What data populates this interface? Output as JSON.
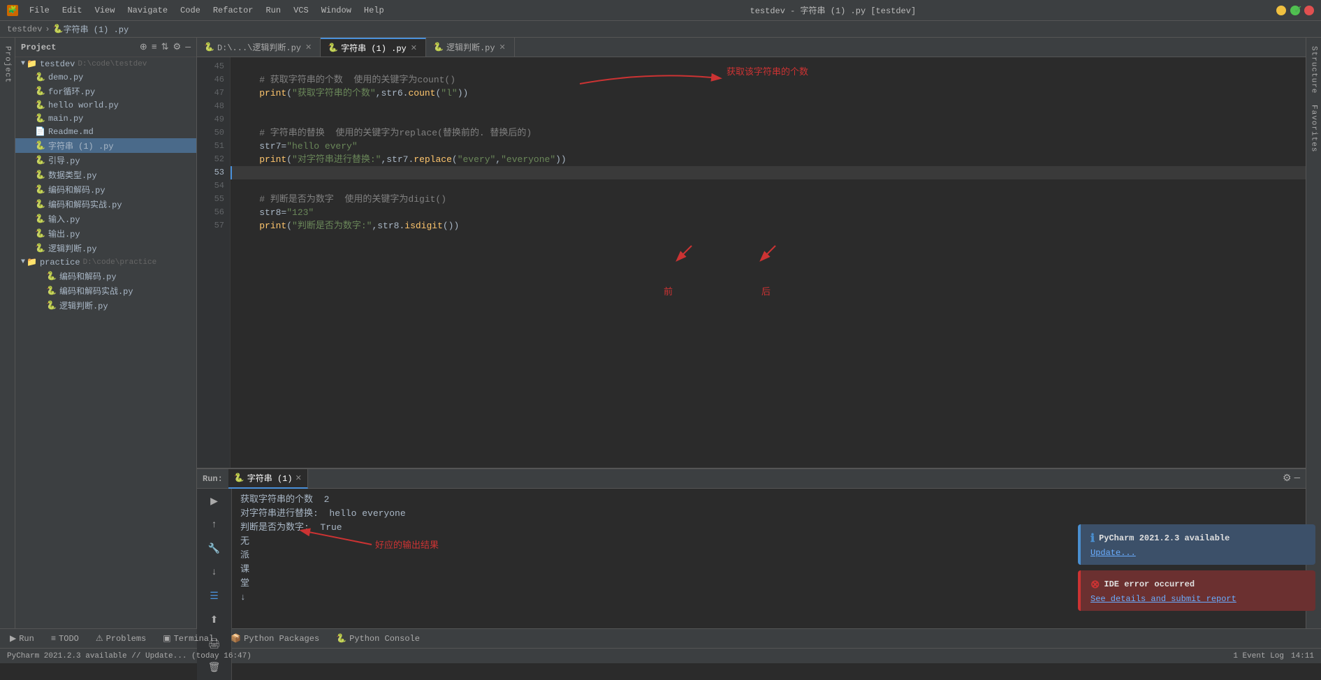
{
  "titleBar": {
    "appIcon": "▶",
    "menu": [
      "File",
      "Edit",
      "View",
      "Navigate",
      "Code",
      "Refactor",
      "Run",
      "VCS",
      "Window",
      "Help"
    ],
    "title": "testdev - 字符串 (1) .py [testdev]",
    "winMin": "—",
    "winMax": "□",
    "winClose": "✕"
  },
  "breadcrumb": {
    "project": "testdev",
    "sep1": "›",
    "file": "字符串 (1) .py"
  },
  "sidebar": {
    "title": "Project",
    "rootFolder": "testdev",
    "rootPath": "D:\\code\\testdev",
    "files": [
      {
        "name": "demo.py",
        "type": "py",
        "indent": 1
      },
      {
        "name": "for循环.py",
        "type": "py",
        "indent": 1
      },
      {
        "name": "hello world.py",
        "type": "py",
        "indent": 1
      },
      {
        "name": "main.py",
        "type": "py",
        "indent": 1
      },
      {
        "name": "Readme.md",
        "type": "md",
        "indent": 1
      },
      {
        "name": "字符串 (1) .py",
        "type": "py",
        "indent": 1,
        "selected": true
      },
      {
        "name": "引导.py",
        "type": "py",
        "indent": 1
      },
      {
        "name": "数据类型.py",
        "type": "py",
        "indent": 1
      },
      {
        "name": "编码和解码.py",
        "type": "py",
        "indent": 1
      },
      {
        "name": "编码和解码实战.py",
        "type": "py",
        "indent": 1
      },
      {
        "name": "输入.py",
        "type": "py",
        "indent": 1
      },
      {
        "name": "输出.py",
        "type": "py",
        "indent": 1
      },
      {
        "name": "逻辑判断.py",
        "type": "py",
        "indent": 1
      }
    ],
    "practiceFolder": "practice",
    "practicePath": "D:\\code\\practice",
    "practiceFiles": [
      {
        "name": "编码和解码.py",
        "type": "py",
        "indent": 2
      },
      {
        "name": "编码和解码实战.py",
        "type": "py",
        "indent": 2
      },
      {
        "name": "逻辑判断.py",
        "type": "py",
        "indent": 2
      }
    ]
  },
  "tabs": [
    {
      "label": "D:\\...\\逻辑判断.py",
      "icon": "🐍",
      "active": false,
      "closable": true
    },
    {
      "label": "字符串 (1) .py",
      "icon": "🐍",
      "active": true,
      "closable": true
    },
    {
      "label": "逻辑判断.py",
      "icon": "🐍",
      "active": false,
      "closable": true
    }
  ],
  "codeLines": [
    {
      "num": 45,
      "text": ""
    },
    {
      "num": 46,
      "text": "    # 获取字符串的个数  使用的关键字为count()",
      "type": "comment"
    },
    {
      "num": 47,
      "text": "    print(\"获取字符串的个数\",str6.count(\"l\"))",
      "type": "code"
    },
    {
      "num": 48,
      "text": ""
    },
    {
      "num": 49,
      "text": ""
    },
    {
      "num": 50,
      "text": "    # 字符串的替换  使用的关键字为replace(替换前的. 替换后的)",
      "type": "comment"
    },
    {
      "num": 51,
      "text": "    str7=\"hello every\"",
      "type": "code"
    },
    {
      "num": 52,
      "text": "    print(\"对字符串进行替换:\",str7.replace(\"every\",\"everyone\"))",
      "type": "code"
    },
    {
      "num": 53,
      "text": "",
      "type": "current"
    },
    {
      "num": 54,
      "text": ""
    },
    {
      "num": 55,
      "text": "    # 判断是否为数字  使用的关键字为digit()",
      "type": "comment"
    },
    {
      "num": 56,
      "text": "    str8=\"123\"",
      "type": "code"
    },
    {
      "num": 57,
      "text": "    print(\"判断是否为数字:\",str8.isdigit())",
      "type": "code"
    }
  ],
  "annotations": {
    "arrow1": "获取该字符串的个数",
    "arrow2": "前",
    "arrow3": "后",
    "arrow4": "好应的输出结果"
  },
  "runPanel": {
    "label": "Run:",
    "tabLabel": "字符串 (1)",
    "output": [
      "获取字符串的个数  2",
      "对字符串进行替换:  hello everyone",
      "判断是否为数字:  True",
      "无",
      "派",
      "课",
      "堂",
      "↓"
    ]
  },
  "notifications": [
    {
      "type": "info",
      "title": "PyCharm 2021.2.3 available",
      "link": "Update..."
    },
    {
      "type": "error",
      "title": "IDE error occurred",
      "link": "See details and submit report"
    }
  ],
  "statusBar": {
    "left": "PyCharm 2021.2.3 available // Update... (today 16:47)",
    "right": "14:11",
    "eventLog": "1 Event Log"
  },
  "bottomTabs": [
    {
      "icon": "▶",
      "label": "Run"
    },
    {
      "icon": "≡",
      "label": "TODO"
    },
    {
      "icon": "⚠",
      "label": "Problems"
    },
    {
      "icon": "▣",
      "label": "Terminal"
    },
    {
      "icon": "📦",
      "label": "Python Packages"
    },
    {
      "icon": "🐍",
      "label": "Python Console"
    }
  ],
  "rightSidebar": {
    "labels": [
      "Structure",
      "Favorites"
    ]
  }
}
